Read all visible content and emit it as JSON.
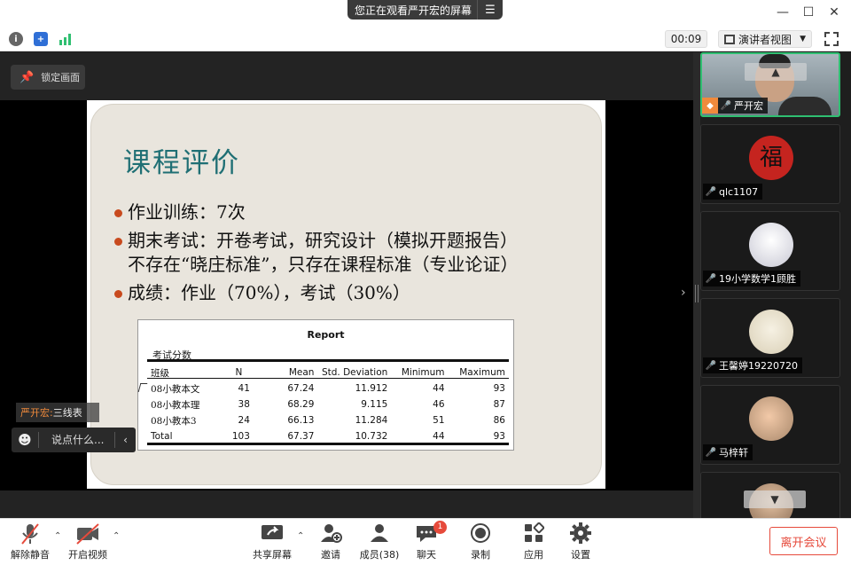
{
  "window": {
    "sharing_banner": "您正在观看严开宏的屏幕",
    "minimize": "—",
    "maximize": "☐",
    "close": "✕"
  },
  "infobar": {
    "timer": "00:09",
    "view_mode": "演讲者视图"
  },
  "share": {
    "lock_label": "锁定画面"
  },
  "slide": {
    "title": "课程评价",
    "bullets": [
      {
        "lines": [
          "作业训练：7次"
        ]
      },
      {
        "lines": [
          "期末考试：开卷考试，研究设计（模拟开题报告）",
          "不存在“晓庄标准”，只存在课程标准（专业论证）"
        ]
      },
      {
        "lines": [
          "成绩：作业（70%），考试（30%）"
        ]
      }
    ],
    "report": {
      "title": "Report",
      "subtitle": "考试分数",
      "headers": [
        "班级",
        "N",
        "Mean",
        "Std. Deviation",
        "Minimum",
        "Maximum"
      ],
      "rows": [
        [
          "08小教本文",
          "41",
          "67.24",
          "11.912",
          "44",
          "93"
        ],
        [
          "08小教本理",
          "38",
          "68.29",
          "9.115",
          "46",
          "87"
        ],
        [
          "08小教本3",
          "24",
          "66.13",
          "11.284",
          "51",
          "86"
        ],
        [
          "Total",
          "103",
          "67.37",
          "10.732",
          "44",
          "93"
        ]
      ]
    }
  },
  "chat": {
    "sender": "严开宏:",
    "message": "三线表",
    "input_placeholder": "说点什么..."
  },
  "participants": [
    {
      "name": "严开宏",
      "mic": "on",
      "active": true
    },
    {
      "name": "qlc1107",
      "mic": "muted"
    },
    {
      "name": "19小学数学1顾胜",
      "mic": "muted"
    },
    {
      "name": "王馨婷19220720",
      "mic": "muted"
    },
    {
      "name": "马梓轩",
      "mic": "muted"
    },
    {
      "name": "",
      "mic": "muted"
    }
  ],
  "toolbar": {
    "mute": "解除静音",
    "video": "开启视频",
    "share": "共享屏幕",
    "invite": "邀请",
    "members": "成员(38)",
    "chat": "聊天",
    "chat_badge": "1",
    "record": "录制",
    "apps": "应用",
    "settings": "设置",
    "leave": "离开会议"
  },
  "colors": {
    "slide_title": "#1f6f74",
    "bullet": "#c84a1e",
    "active_border": "#2fbf71",
    "leave": "#e64a3b"
  }
}
